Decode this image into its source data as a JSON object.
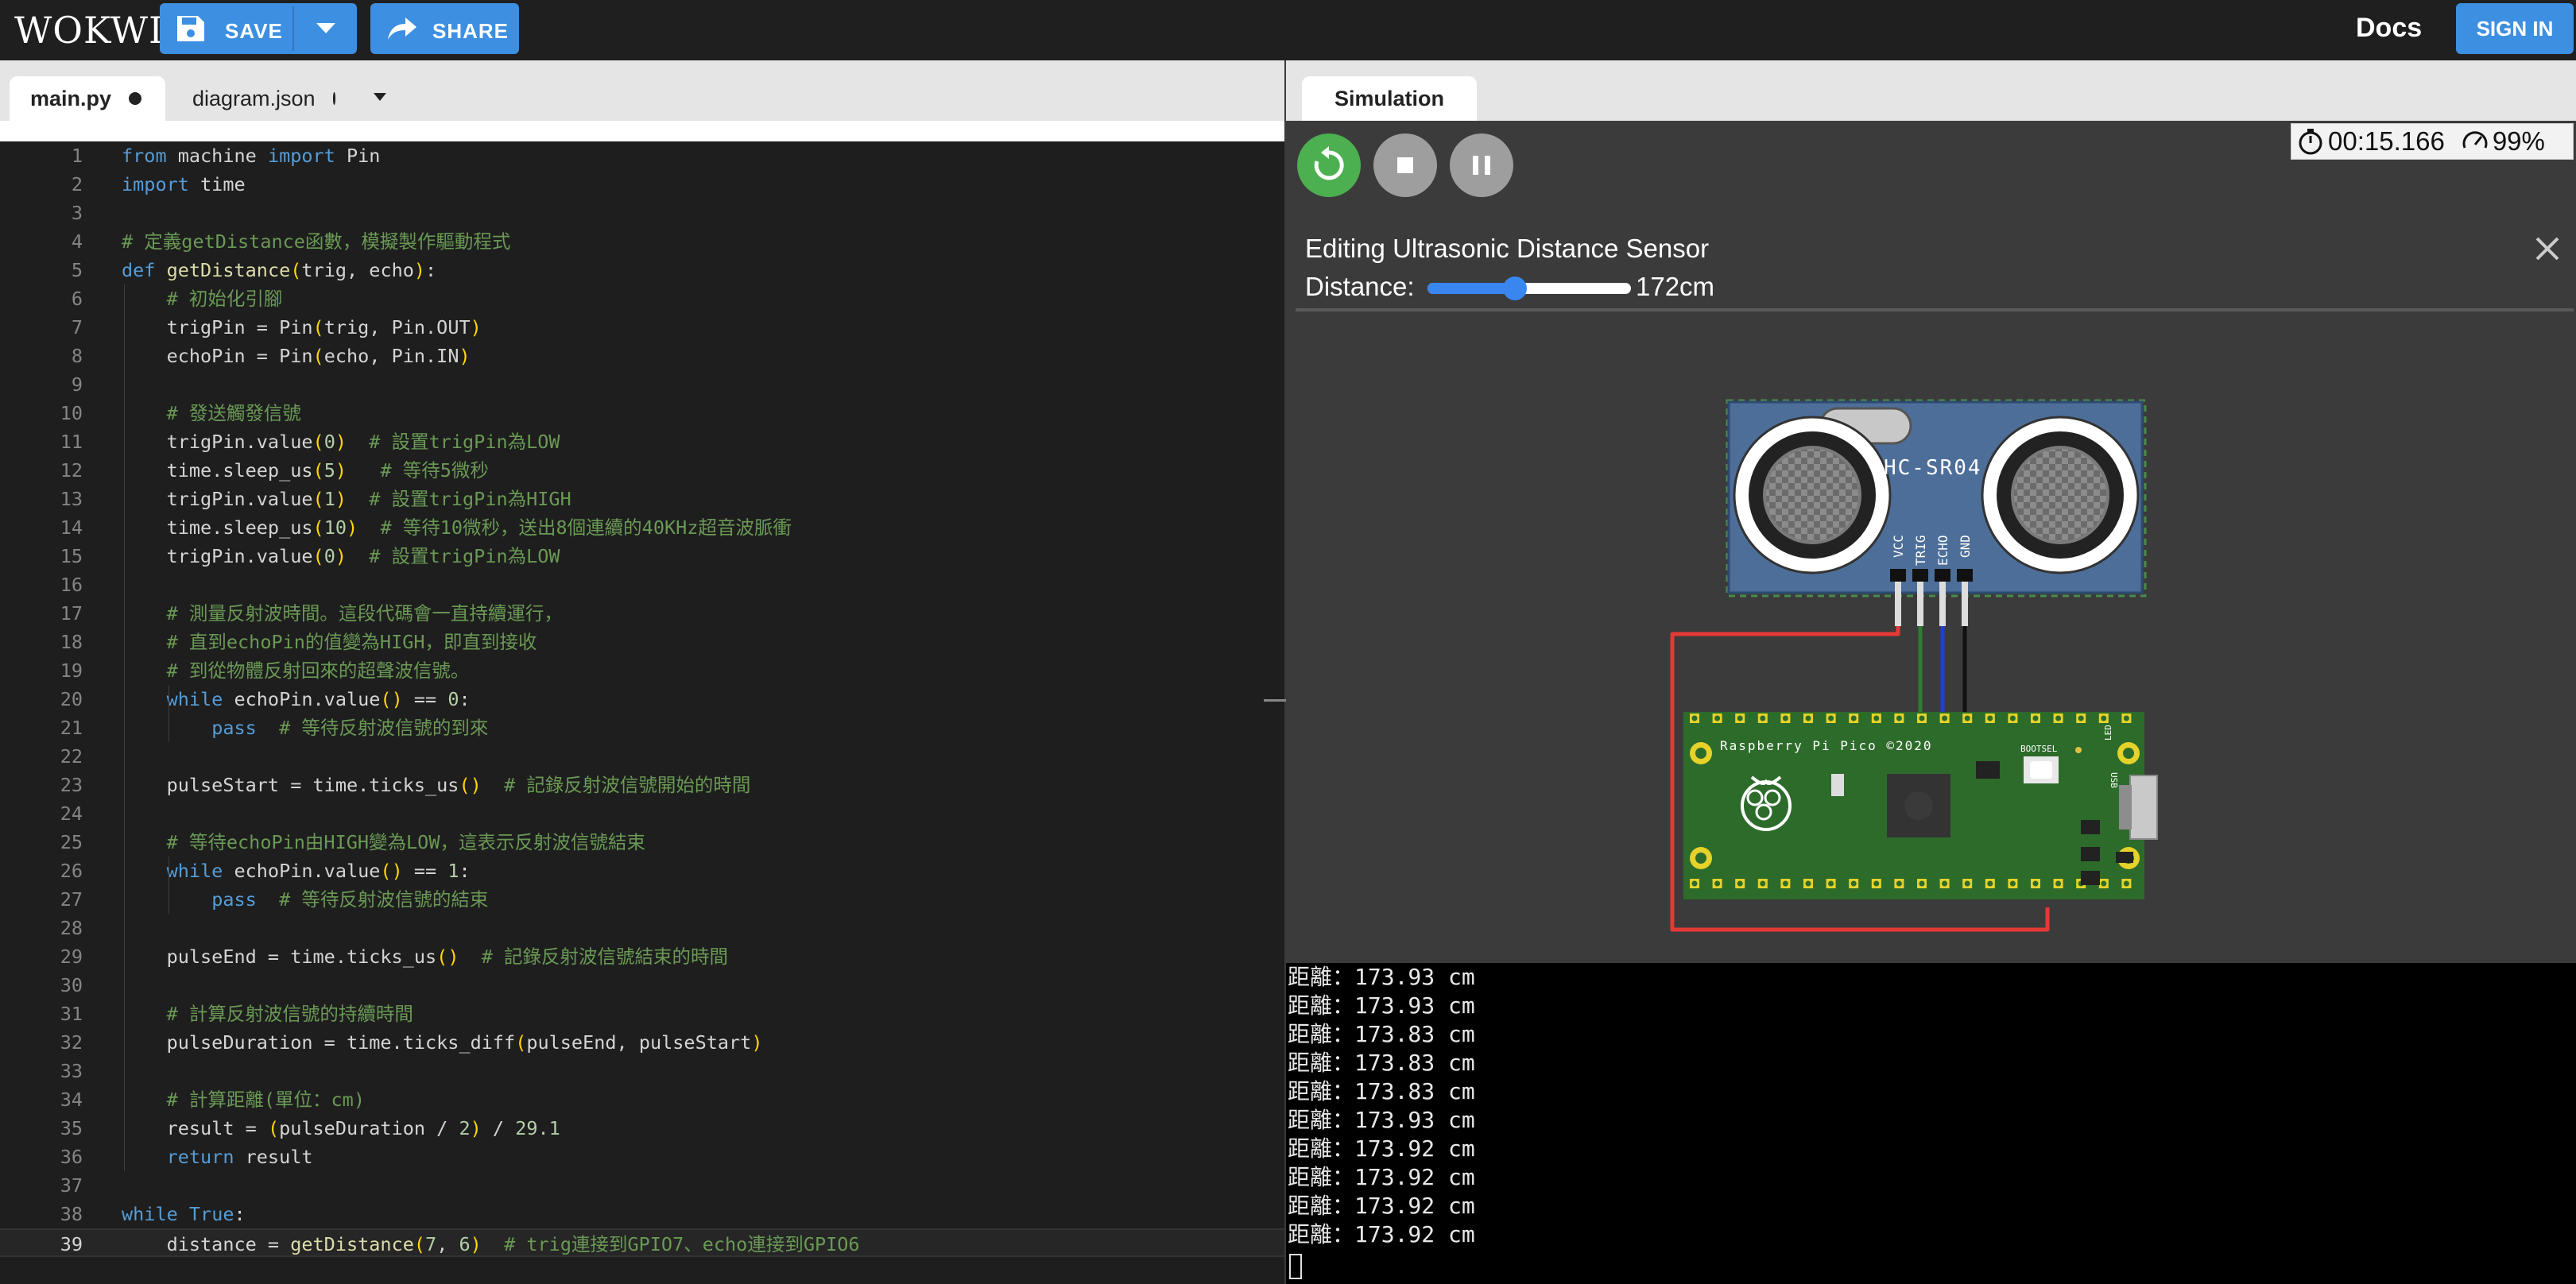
{
  "header": {
    "logo": "WOKWI",
    "save_label": "SAVE",
    "share_label": "SHARE",
    "docs_label": "Docs",
    "signin_label": "SIGN IN"
  },
  "editor": {
    "tabs": [
      {
        "label": "main.py",
        "active": true,
        "modified": true
      },
      {
        "label": "diagram.json",
        "active": false,
        "modified": true
      }
    ],
    "current_line": 39,
    "lines": [
      {
        "n": "1",
        "text": "from machine import Pin"
      },
      {
        "n": "2",
        "text": "import time"
      },
      {
        "n": "3",
        "text": ""
      },
      {
        "n": "4",
        "text": "# 定義getDistance函數，模擬製作驅動程式"
      },
      {
        "n": "5",
        "text": "def getDistance(trig, echo):"
      },
      {
        "n": "6",
        "text": "    # 初始化引腳"
      },
      {
        "n": "7",
        "text": "    trigPin = Pin(trig, Pin.OUT)"
      },
      {
        "n": "8",
        "text": "    echoPin = Pin(echo, Pin.IN)"
      },
      {
        "n": "9",
        "text": ""
      },
      {
        "n": "10",
        "text": "    # 發送觸發信號"
      },
      {
        "n": "11",
        "text": "    trigPin.value(0)  # 設置trigPin為LOW"
      },
      {
        "n": "12",
        "text": "    time.sleep_us(5)   # 等待5微秒"
      },
      {
        "n": "13",
        "text": "    trigPin.value(1)  # 設置trigPin為HIGH"
      },
      {
        "n": "14",
        "text": "    time.sleep_us(10)  # 等待10微秒，送出8個連續的40KHz超音波脈衝"
      },
      {
        "n": "15",
        "text": "    trigPin.value(0)  # 設置trigPin為LOW"
      },
      {
        "n": "16",
        "text": ""
      },
      {
        "n": "17",
        "text": "    # 測量反射波時間。這段代碼會一直持續運行，"
      },
      {
        "n": "18",
        "text": "    # 直到echoPin的值變為HIGH，即直到接收"
      },
      {
        "n": "19",
        "text": "    # 到從物體反射回來的超聲波信號。"
      },
      {
        "n": "20",
        "text": "    while echoPin.value() == 0:"
      },
      {
        "n": "21",
        "text": "        pass  # 等待反射波信號的到來"
      },
      {
        "n": "22",
        "text": ""
      },
      {
        "n": "23",
        "text": "    pulseStart = time.ticks_us()  # 記錄反射波信號開始的時間"
      },
      {
        "n": "24",
        "text": ""
      },
      {
        "n": "25",
        "text": "    # 等待echoPin由HIGH變為LOW，這表示反射波信號結束"
      },
      {
        "n": "26",
        "text": "    while echoPin.value() == 1:"
      },
      {
        "n": "27",
        "text": "        pass  # 等待反射波信號的結束"
      },
      {
        "n": "28",
        "text": ""
      },
      {
        "n": "29",
        "text": "    pulseEnd = time.ticks_us()  # 記錄反射波信號結束的時間"
      },
      {
        "n": "30",
        "text": ""
      },
      {
        "n": "31",
        "text": "    # 計算反射波信號的持續時間"
      },
      {
        "n": "32",
        "text": "    pulseDuration = time.ticks_diff(pulseEnd, pulseStart)"
      },
      {
        "n": "33",
        "text": ""
      },
      {
        "n": "34",
        "text": "    # 計算距離(單位：cm)"
      },
      {
        "n": "35",
        "text": "    result = (pulseDuration / 2) / 29.1"
      },
      {
        "n": "36",
        "text": "    return result"
      },
      {
        "n": "37",
        "text": ""
      },
      {
        "n": "38",
        "text": "while True:"
      },
      {
        "n": "39",
        "text": "    distance = getDistance(7, 6)  # trig連接到GPIO7、echo連接到GPIO6"
      }
    ]
  },
  "simulation": {
    "tab_label": "Simulation",
    "timer": "00:15.166",
    "speed": "99%",
    "editing_title": "Editing Ultrasonic Distance Sensor",
    "distance_label": "Distance:",
    "distance_value": "172cm",
    "distance_fraction": 0.43,
    "sensor": {
      "model": "HC-SR04",
      "pins": [
        "VCC",
        "TRIG",
        "ECHO",
        "GND"
      ]
    },
    "board": {
      "label": "Raspberry Pi Pico ©2020",
      "bootsel": "BOOTSEL",
      "usb": "USB",
      "led": "LED"
    },
    "colors": {
      "sensor_body": "#4d6e99",
      "board": "#2d6b2a",
      "wire_vcc": "#e53935",
      "wire_trig": "#2e7d32",
      "wire_echo": "#1e3fd6",
      "wire_gnd": "#111111",
      "accent": "#3d8fe1"
    }
  },
  "console": {
    "lines": [
      "距離：173.93 cm",
      "距離：173.93 cm",
      "距離：173.83 cm",
      "距離：173.83 cm",
      "距離：173.83 cm",
      "距離：173.93 cm",
      "距離：173.92 cm",
      "距離：173.92 cm",
      "距離：173.92 cm",
      "距離：173.92 cm"
    ]
  }
}
